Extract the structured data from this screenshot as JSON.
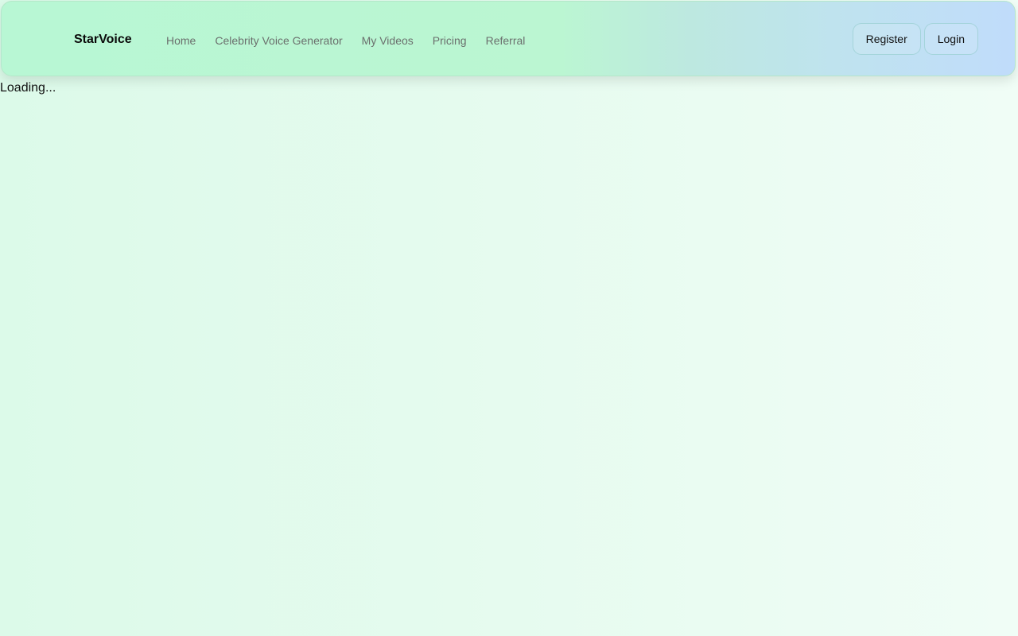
{
  "header": {
    "brand": "StarVoice",
    "nav": [
      {
        "label": "Home"
      },
      {
        "label": "Celebrity Voice Generator"
      },
      {
        "label": "My Videos"
      },
      {
        "label": "Pricing"
      },
      {
        "label": "Referral"
      }
    ],
    "auth": {
      "register_label": "Register",
      "login_label": "Login"
    }
  },
  "main": {
    "status_text": "Loading..."
  },
  "colors": {
    "nav_gradient_start": "#b8f7d4",
    "nav_gradient_end": "#c0dcfb",
    "page_background": "#e3fbee",
    "nav_link_text": "#6b6f6d"
  }
}
